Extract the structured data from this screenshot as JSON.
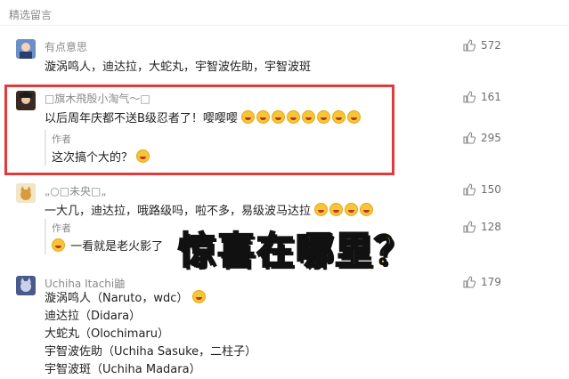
{
  "section_title": "精选留言",
  "comments": [
    {
      "nickname": "有点意思",
      "text": "漩涡鸣人，迪达拉，大蛇丸，宇智波佐助，宇智波斑",
      "likes": "572",
      "avatar_icon": "anime-avatar"
    },
    {
      "nickname": "□旗木飛殷小淘气～□",
      "text": "以后周年庆都不送B级忍者了！嘤嘤嘤",
      "likes": "161",
      "author_label": "作者",
      "author_reply": "这次搞个大的？",
      "author_likes": "295",
      "avatar_icon": "character-avatar"
    },
    {
      "nickname": "„○□未央□„",
      "text": "一大几，迪达拉，哦路级吗，啦不多，易级波马达拉",
      "likes": "150",
      "author_label": "作者",
      "author_reply": "一看就是老火影了",
      "author_likes": "128",
      "avatar_icon": "cat-avatar"
    },
    {
      "nickname": "Uchiha Itachi鼬",
      "lines": [
        "漩涡鸣人（Naruto，wdc）",
        "迪达拉（Didara）",
        "大蛇丸（Olochimaru）",
        "宇智波佐助（Uchiha Sasuke，二柱子）",
        "宇智波斑（Uchiha Madara）"
      ],
      "likes": "179",
      "avatar_icon": "ninja-cat-avatar"
    }
  ],
  "overlay_caption": "惊喜在哪里？",
  "colors": {
    "highlight_border": "#e23b3b",
    "overlay_fill": "#ffd400",
    "text_gray": "#8a8a8a"
  }
}
